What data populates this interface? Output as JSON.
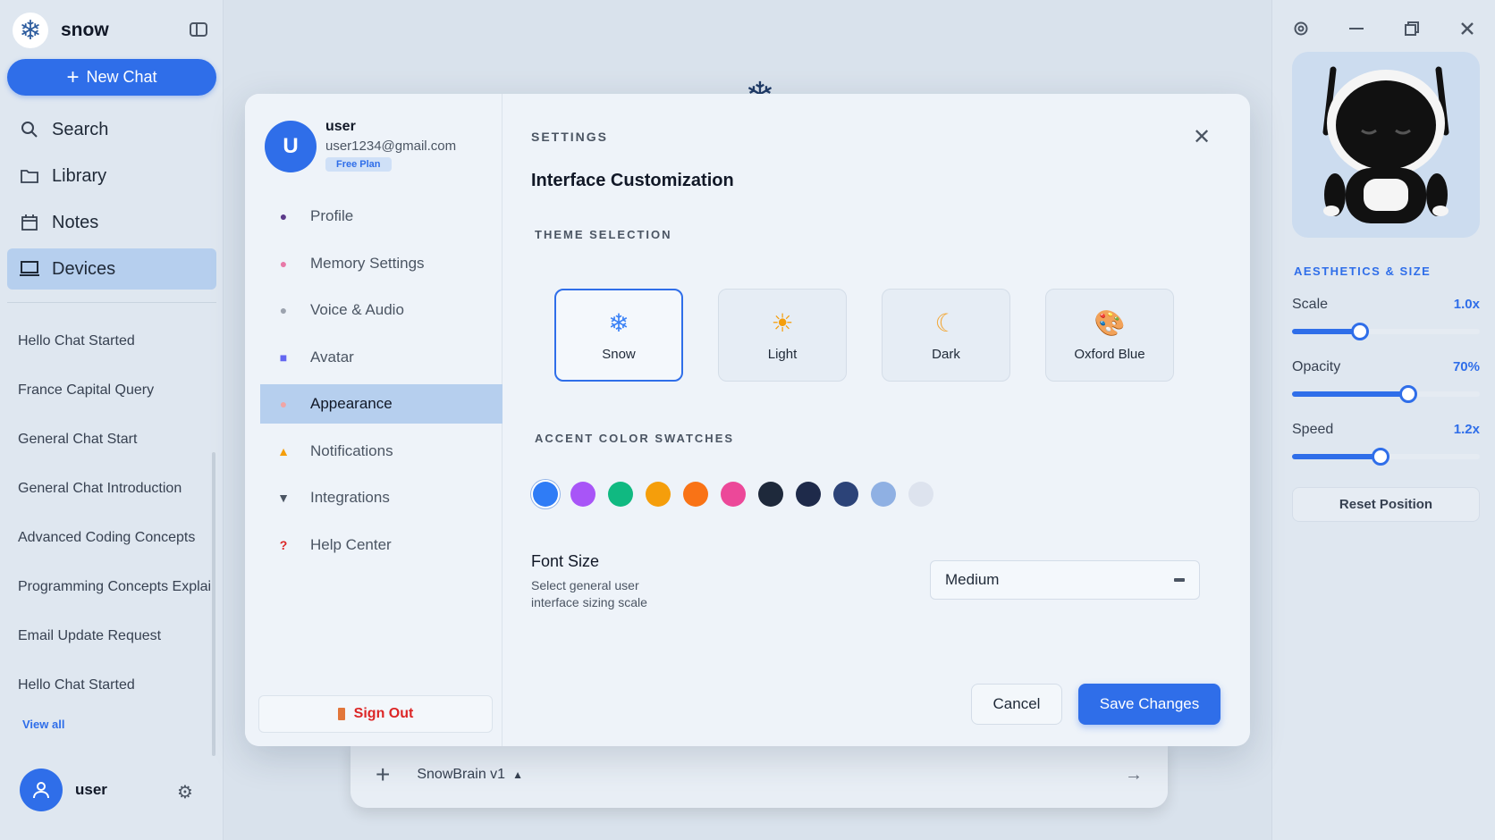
{
  "app": {
    "name": "snow"
  },
  "sidebar": {
    "new_chat_label": "New Chat",
    "nav": [
      {
        "label": "Search",
        "icon": "search-icon"
      },
      {
        "label": "Library",
        "icon": "folder-icon"
      },
      {
        "label": "Notes",
        "icon": "calendar-icon"
      },
      {
        "label": "Devices",
        "icon": "laptop-icon",
        "active": true
      }
    ],
    "history": [
      "Hello Chat Started",
      "France Capital Query",
      "General Chat Start",
      "General Chat Introduction",
      "Advanced Coding Concepts",
      "Programming Concepts Explai",
      "Email Update Request",
      "Hello Chat Started"
    ],
    "view_all": "View all",
    "user_name": "user"
  },
  "composer": {
    "model": "SnowBrain v1"
  },
  "right_panel": {
    "section_label": "AESTHETICS & SIZE",
    "sliders": {
      "scale": {
        "label": "Scale",
        "value": "1.0x",
        "level": 0.36
      },
      "opacity": {
        "label": "Opacity",
        "value": "70%",
        "level": 0.62
      },
      "speed": {
        "label": "Speed",
        "value": "1.2x",
        "level": 0.47
      }
    },
    "reset_label": "Reset Position"
  },
  "modal": {
    "profile": {
      "initial": "U",
      "name": "user",
      "email": "user1234@gmail.com",
      "plan": "Free Plan"
    },
    "menu": [
      {
        "label": "Profile",
        "icon": "person-icon"
      },
      {
        "label": "Memory Settings",
        "icon": "brain-icon"
      },
      {
        "label": "Voice & Audio",
        "icon": "microphone-icon"
      },
      {
        "label": "Avatar",
        "icon": "robot-icon"
      },
      {
        "label": "Appearance",
        "icon": "palette-icon",
        "active": true
      },
      {
        "label": "Notifications",
        "icon": "bell-icon"
      },
      {
        "label": "Integrations",
        "icon": "plug-icon"
      },
      {
        "label": "Help Center",
        "icon": "question-icon"
      }
    ],
    "sign_out": "Sign Out",
    "eyebrow": "SETTINGS",
    "title": "Interface Customization",
    "theme_section": "THEME SELECTION",
    "themes": [
      {
        "label": "Snow",
        "icon": "snowflake-icon",
        "glyph": "❄",
        "selected": true
      },
      {
        "label": "Light",
        "icon": "sun-icon",
        "glyph": "☀"
      },
      {
        "label": "Dark",
        "icon": "moon-icon",
        "glyph": "☾"
      },
      {
        "label": "Oxford Blue",
        "icon": "palette-icon",
        "glyph": "🎨"
      }
    ],
    "accent_section": "ACCENT COLOR SWATCHES",
    "swatches": [
      "#2f7cf6",
      "#a855f7",
      "#10b981",
      "#f59e0b",
      "#f97316",
      "#ec4899",
      "#1e293b",
      "#1e2a4a",
      "#2c4378",
      "#8fb0e3",
      "#dde3ee"
    ],
    "font_size": {
      "label": "Font Size",
      "help": "Select general user interface sizing scale",
      "value": "Medium"
    },
    "cancel": "Cancel",
    "save": "Save Changes"
  }
}
